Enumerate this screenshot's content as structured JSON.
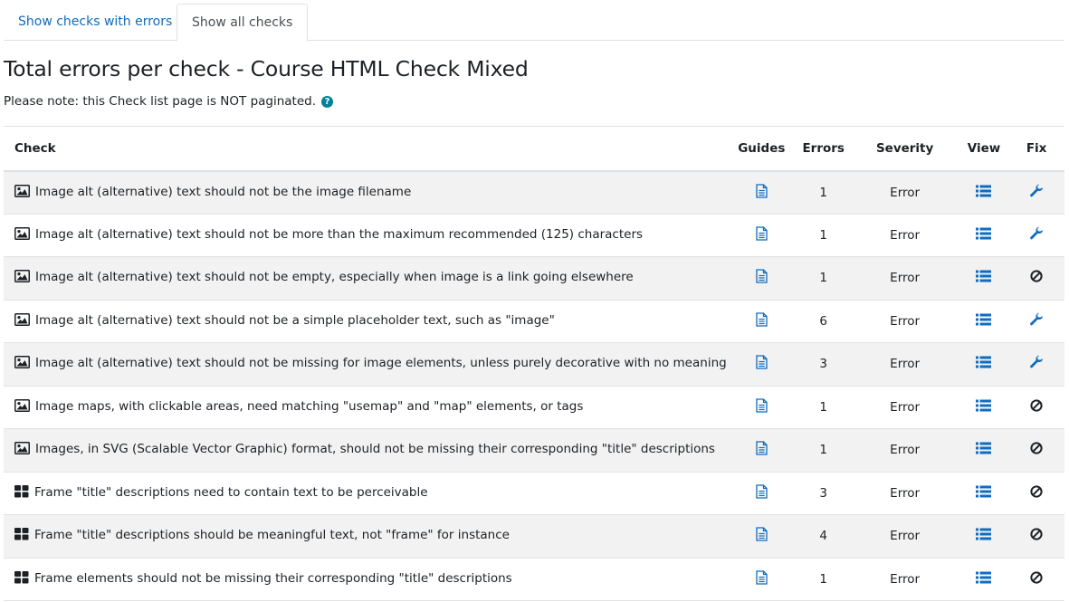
{
  "tabs": [
    {
      "label": "Show checks with errors",
      "active": false
    },
    {
      "label": "Show all checks",
      "active": true
    }
  ],
  "page_title": "Total errors per check - Course HTML Check Mixed",
  "note": "Please note: this Check list page is NOT paginated.",
  "help_icon": "question-circle-icon",
  "colors": {
    "link": "#0f6cbf",
    "help": "#008196",
    "icon_blue": "#0f6cbf",
    "row_stripe": "#f2f2f2"
  },
  "table": {
    "headers": {
      "check": "Check",
      "guides": "Guides",
      "errors": "Errors",
      "severity": "Severity",
      "view": "View",
      "fix": "Fix"
    },
    "rows": [
      {
        "type_icon": "image-icon",
        "check": "Image alt (alternative) text should not be the image filename",
        "errors": "1",
        "severity": "Error",
        "fix_icon": "wrench-icon"
      },
      {
        "type_icon": "image-icon",
        "check": "Image alt (alternative) text should not be more than the maximum recommended (125) characters",
        "errors": "1",
        "severity": "Error",
        "fix_icon": "wrench-icon"
      },
      {
        "type_icon": "image-icon",
        "check": "Image alt (alternative) text should not be empty, especially when image is a link going elsewhere",
        "errors": "1",
        "severity": "Error",
        "fix_icon": "ban-icon"
      },
      {
        "type_icon": "image-icon",
        "check": "Image alt (alternative) text should not be a simple placeholder text, such as \"image\"",
        "errors": "6",
        "severity": "Error",
        "fix_icon": "wrench-icon"
      },
      {
        "type_icon": "image-icon",
        "check": "Image alt (alternative) text should not be missing for image elements, unless purely decorative with no meaning",
        "errors": "3",
        "severity": "Error",
        "fix_icon": "wrench-icon"
      },
      {
        "type_icon": "image-icon",
        "check": "Image maps, with clickable areas, need matching \"usemap\" and \"map\" elements, or tags",
        "errors": "1",
        "severity": "Error",
        "fix_icon": "ban-icon"
      },
      {
        "type_icon": "image-icon",
        "check": "Images, in SVG (Scalable Vector Graphic) format, should not be missing their corresponding \"title\" descriptions",
        "errors": "1",
        "severity": "Error",
        "fix_icon": "ban-icon"
      },
      {
        "type_icon": "frame-icon",
        "check": "Frame \"title\" descriptions need to contain text to be perceivable",
        "errors": "3",
        "severity": "Error",
        "fix_icon": "ban-icon"
      },
      {
        "type_icon": "frame-icon",
        "check": "Frame \"title\" descriptions should be meaningful text, not \"frame\" for instance",
        "errors": "4",
        "severity": "Error",
        "fix_icon": "ban-icon"
      },
      {
        "type_icon": "frame-icon",
        "check": "Frame elements should not be missing their corresponding \"title\" descriptions",
        "errors": "1",
        "severity": "Error",
        "fix_icon": "ban-icon"
      }
    ]
  }
}
